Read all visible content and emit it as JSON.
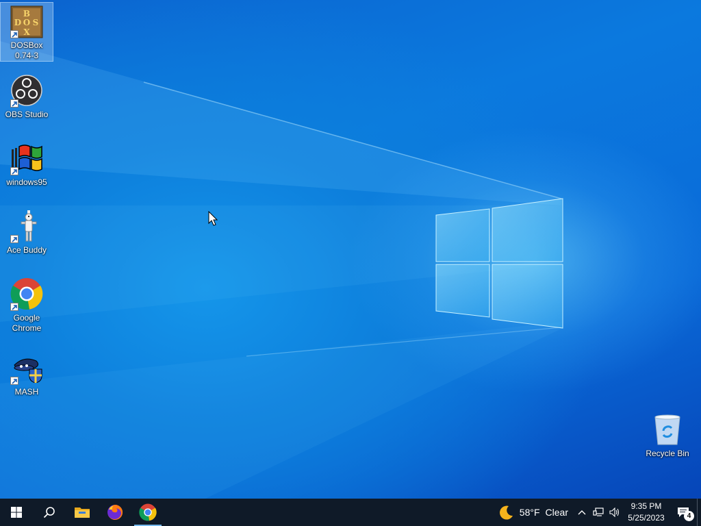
{
  "desktop": {
    "icons": [
      {
        "label": "DOSBox\n0.74-3",
        "icon": "dosbox-icon",
        "selected": true
      },
      {
        "label": "OBS Studio",
        "icon": "obs-icon"
      },
      {
        "label": "windows95",
        "icon": "windows95-icon"
      },
      {
        "label": "Ace Buddy",
        "icon": "ace-buddy-icon"
      },
      {
        "label": "Google\nChrome",
        "icon": "chrome-icon"
      },
      {
        "label": "MASH",
        "icon": "mash-icon"
      }
    ],
    "recycle_bin": {
      "label": "Recycle Bin",
      "icon": "recycle-bin-icon"
    },
    "dosbox_letters": [
      "B",
      "D",
      "O",
      "S",
      "X"
    ]
  },
  "taskbar": {
    "start": "start-icon",
    "search": "search-icon",
    "pinned": [
      {
        "name": "file-explorer",
        "icon": "folder-icon"
      },
      {
        "name": "firefox",
        "icon": "firefox-icon"
      },
      {
        "name": "chrome",
        "icon": "chrome-icon",
        "active": true
      }
    ],
    "weather": {
      "temperature": "58°F",
      "condition": "Clear",
      "icon": "moon-icon"
    },
    "tray_icons": [
      "chevron-up-icon",
      "network-icon",
      "volume-icon"
    ],
    "clock": {
      "time": "9:35 PM",
      "date": "5/25/2023"
    },
    "notifications": {
      "count": "4",
      "icon": "action-center-icon"
    }
  },
  "colors": {
    "taskbar": "#0f1a28",
    "wallpaper_blue": "#0a6fd6",
    "active_indicator": "#76b9ed"
  }
}
